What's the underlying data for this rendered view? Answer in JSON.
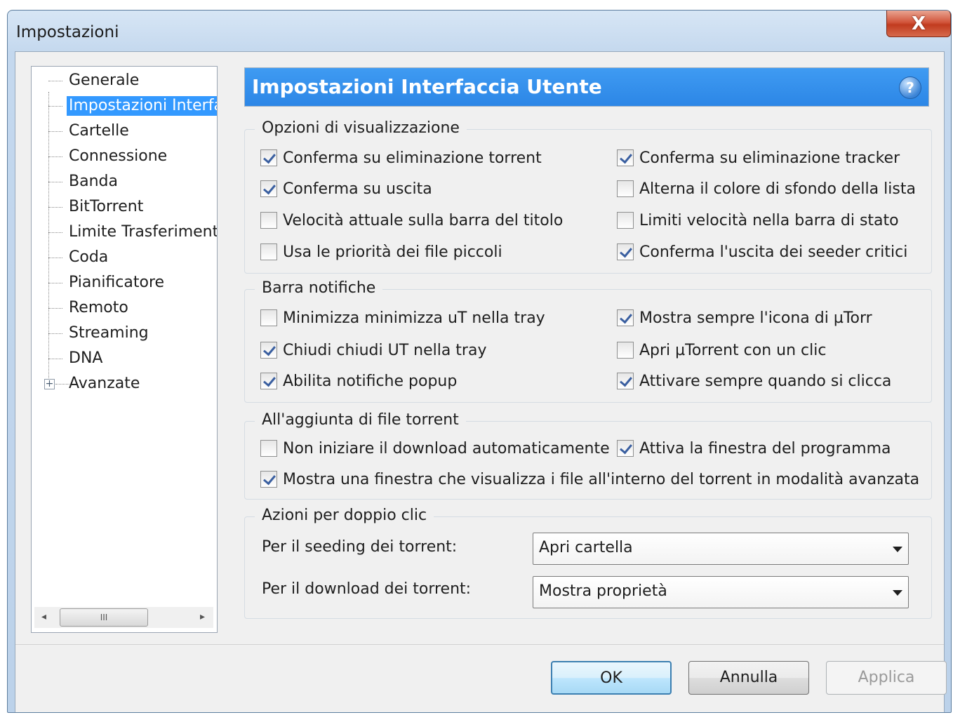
{
  "window": {
    "title": "Impostazioni",
    "close_glyph": "X"
  },
  "tree": {
    "items": [
      {
        "label": "Generale",
        "selected": false
      },
      {
        "label": "Impostazioni Interfa",
        "selected": true
      },
      {
        "label": "Cartelle",
        "selected": false
      },
      {
        "label": "Connessione",
        "selected": false
      },
      {
        "label": "Banda",
        "selected": false
      },
      {
        "label": "BitTorrent",
        "selected": false
      },
      {
        "label": "Limite Trasferimenti",
        "selected": false
      },
      {
        "label": "Coda",
        "selected": false
      },
      {
        "label": "Pianificatore",
        "selected": false
      },
      {
        "label": "Remoto",
        "selected": false
      },
      {
        "label": "Streaming",
        "selected": false
      },
      {
        "label": "DNA",
        "selected": false
      },
      {
        "label": "Avanzate",
        "selected": false,
        "expandable": true
      }
    ],
    "expander_glyph": "+",
    "scroll_left": "◂",
    "scroll_right": "▸",
    "scroll_thumb_grip": "III"
  },
  "header": {
    "title": "Impostazioni Interfaccia Utente",
    "help_glyph": "?"
  },
  "display_options": {
    "label": "Opzioni di visualizzazione",
    "left": [
      {
        "label": "Conferma su eliminazione torrent",
        "checked": true
      },
      {
        "label": "Conferma su uscita",
        "checked": true
      },
      {
        "label": "Velocità attuale sulla barra del titolo",
        "checked": false
      },
      {
        "label": "Usa le priorità dei file piccoli",
        "checked": false
      }
    ],
    "right": [
      {
        "label": "Conferma su eliminazione tracker",
        "checked": true
      },
      {
        "label": "Alterna il colore di sfondo della lista",
        "checked": false
      },
      {
        "label": "Limiti velocità nella barra di stato",
        "checked": false
      },
      {
        "label": "Conferma l'uscita dei seeder critici",
        "checked": true
      }
    ]
  },
  "tray": {
    "label": "Barra notifiche",
    "left": [
      {
        "label": "Minimizza minimizza uT nella tray",
        "checked": false
      },
      {
        "label": "Chiudi chiudi UT nella tray",
        "checked": true
      },
      {
        "label": "Abilita notifiche popup",
        "checked": true
      }
    ],
    "right": [
      {
        "label": "Mostra sempre l'icona di µTorr",
        "checked": true
      },
      {
        "label": "Apri µTorrent con un clic",
        "checked": false
      },
      {
        "label": "Attivare sempre quando si clicca",
        "checked": true
      }
    ]
  },
  "adding": {
    "label": "All'aggiunta di file torrent",
    "no_autostart": {
      "label": "Non iniziare il download automaticamente",
      "checked": false
    },
    "activate_window": {
      "label": "Attiva la finestra del programma",
      "checked": true
    },
    "show_files": {
      "label": "Mostra una finestra che visualizza i file all'interno del torrent in modalità avanzata",
      "checked": true
    }
  },
  "double_click": {
    "label": "Azioni per doppio clic",
    "seeding_label": "Per il seeding dei torrent:",
    "seeding_value": "Apri cartella",
    "downloading_label": "Per il download dei torrent:",
    "downloading_value": "Mostra proprietà"
  },
  "buttons": {
    "ok": "OK",
    "cancel": "Annulla",
    "apply": "Applica"
  }
}
